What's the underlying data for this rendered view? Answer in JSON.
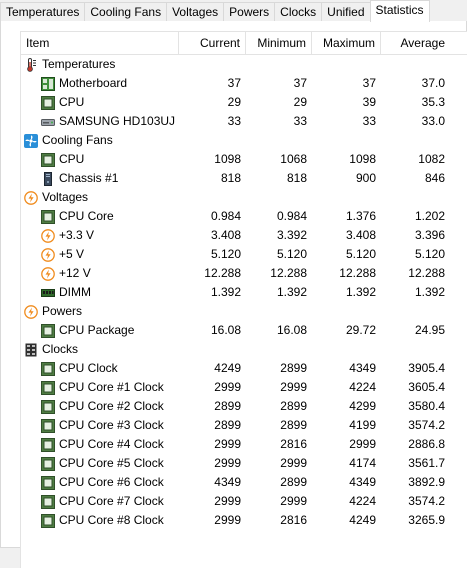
{
  "tabs": [
    "Temperatures",
    "Cooling Fans",
    "Voltages",
    "Powers",
    "Clocks",
    "Unified",
    "Statistics"
  ],
  "active_tab": "Statistics",
  "columns": [
    "Item",
    "Current",
    "Minimum",
    "Maximum",
    "Average"
  ],
  "groups": [
    {
      "label": "Temperatures",
      "icon": "thermometer-icon",
      "items": [
        {
          "label": "Motherboard",
          "icon": "motherboard-icon",
          "values": [
            "37",
            "37",
            "37",
            "37.0"
          ]
        },
        {
          "label": "CPU",
          "icon": "chip-icon",
          "values": [
            "29",
            "29",
            "39",
            "35.3"
          ]
        },
        {
          "label": "SAMSUNG HD103UJ",
          "icon": "hard-drive-icon",
          "values": [
            "33",
            "33",
            "33",
            "33.0"
          ]
        }
      ]
    },
    {
      "label": "Cooling Fans",
      "icon": "fan-icon",
      "items": [
        {
          "label": "CPU",
          "icon": "chip-icon",
          "values": [
            "1098",
            "1068",
            "1098",
            "1082"
          ]
        },
        {
          "label": "Chassis #1",
          "icon": "chassis-icon",
          "values": [
            "818",
            "818",
            "900",
            "846"
          ]
        }
      ]
    },
    {
      "label": "Voltages",
      "icon": "voltage-icon",
      "items": [
        {
          "label": "CPU Core",
          "icon": "chip-icon",
          "values": [
            "0.984",
            "0.984",
            "1.376",
            "1.202"
          ]
        },
        {
          "label": "+3.3 V",
          "icon": "voltage-icon",
          "values": [
            "3.408",
            "3.392",
            "3.408",
            "3.396"
          ]
        },
        {
          "label": "+5 V",
          "icon": "voltage-icon",
          "values": [
            "5.120",
            "5.120",
            "5.120",
            "5.120"
          ]
        },
        {
          "label": "+12 V",
          "icon": "voltage-icon",
          "values": [
            "12.288",
            "12.288",
            "12.288",
            "12.288"
          ]
        },
        {
          "label": "DIMM",
          "icon": "memory-icon",
          "values": [
            "1.392",
            "1.392",
            "1.392",
            "1.392"
          ]
        }
      ]
    },
    {
      "label": "Powers",
      "icon": "voltage-icon",
      "items": [
        {
          "label": "CPU Package",
          "icon": "chip-icon",
          "values": [
            "16.08",
            "16.08",
            "29.72",
            "24.95"
          ]
        }
      ]
    },
    {
      "label": "Clocks",
      "icon": "clock-icon",
      "items": [
        {
          "label": "CPU Clock",
          "icon": "chip-icon",
          "values": [
            "4249",
            "2899",
            "4349",
            "3905.4"
          ]
        },
        {
          "label": "CPU Core #1 Clock",
          "icon": "chip-icon",
          "values": [
            "2999",
            "2999",
            "4224",
            "3605.4"
          ]
        },
        {
          "label": "CPU Core #2 Clock",
          "icon": "chip-icon",
          "values": [
            "2899",
            "2899",
            "4299",
            "3580.4"
          ]
        },
        {
          "label": "CPU Core #3 Clock",
          "icon": "chip-icon",
          "values": [
            "2899",
            "2899",
            "4199",
            "3574.2"
          ]
        },
        {
          "label": "CPU Core #4 Clock",
          "icon": "chip-icon",
          "values": [
            "2999",
            "2816",
            "2999",
            "2886.8"
          ]
        },
        {
          "label": "CPU Core #5 Clock",
          "icon": "chip-icon",
          "values": [
            "2999",
            "2999",
            "4174",
            "3561.7"
          ]
        },
        {
          "label": "CPU Core #6 Clock",
          "icon": "chip-icon",
          "values": [
            "4349",
            "2899",
            "4349",
            "3892.9"
          ]
        },
        {
          "label": "CPU Core #7 Clock",
          "icon": "chip-icon",
          "values": [
            "2999",
            "2999",
            "4224",
            "3574.2"
          ]
        },
        {
          "label": "CPU Core #8 Clock",
          "icon": "chip-icon",
          "values": [
            "2999",
            "2816",
            "4249",
            "3265.9"
          ]
        }
      ]
    }
  ],
  "colors": {
    "chip": "#4f7d43",
    "voltage": "#f08c1e",
    "fan": "#2a8fd8",
    "thermo": "#c0392b"
  }
}
